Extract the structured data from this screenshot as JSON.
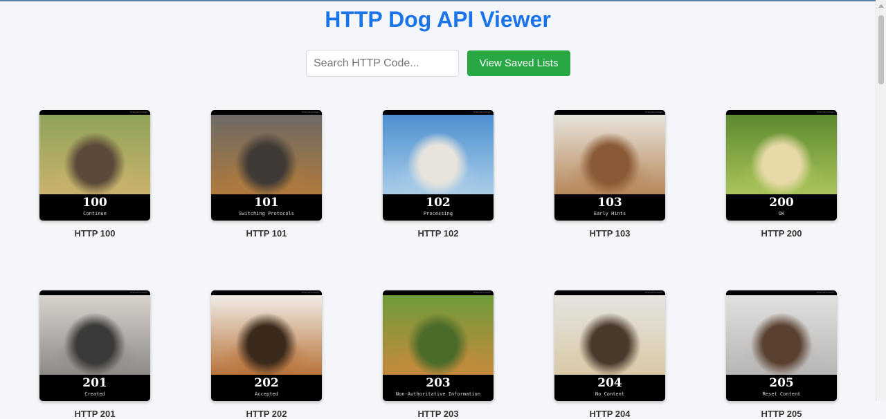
{
  "title": "HTTP Dog API Viewer",
  "search": {
    "placeholder": "Search HTTP Code..."
  },
  "saved_button_label": "View Saved Lists",
  "watermark": "httpstatusdogs",
  "cards": [
    {
      "code": "100",
      "text": "Continue",
      "caption": "HTTP 100",
      "colors": [
        "#8fa35a",
        "#c9b26b",
        "#5b4a3a"
      ]
    },
    {
      "code": "101",
      "text": "Switching Protocols",
      "caption": "HTTP 101",
      "colors": [
        "#6d6a66",
        "#b07a3c",
        "#3f3a36"
      ]
    },
    {
      "code": "102",
      "text": "Processing",
      "caption": "HTTP 102",
      "colors": [
        "#4d8fd0",
        "#a9cde8",
        "#e8e4dc"
      ]
    },
    {
      "code": "103",
      "text": "Early Hints",
      "caption": "HTTP 103",
      "colors": [
        "#e8e4dc",
        "#b6875a",
        "#8a5a36"
      ]
    },
    {
      "code": "200",
      "text": "OK",
      "caption": "HTTP 200",
      "colors": [
        "#5c8a2e",
        "#a9c35a",
        "#e8d9a8"
      ]
    },
    {
      "code": "201",
      "text": "Created",
      "caption": "HTTP 201",
      "colors": [
        "#d8d2cc",
        "#8e8a86",
        "#3c3a38"
      ]
    },
    {
      "code": "202",
      "text": "Accepted",
      "caption": "HTTP 202",
      "colors": [
        "#f0ece6",
        "#b8733a",
        "#3b2a1c"
      ]
    },
    {
      "code": "203",
      "text": "Non-Authoritative Information",
      "caption": "HTTP 203",
      "colors": [
        "#6f9a3a",
        "#c58a3c",
        "#4a6b2a"
      ]
    },
    {
      "code": "204",
      "text": "No Content",
      "caption": "HTTP 204",
      "colors": [
        "#e6e4e0",
        "#d9c9a8",
        "#4a3a2c"
      ]
    },
    {
      "code": "205",
      "text": "Reset Content",
      "caption": "HTTP 205",
      "colors": [
        "#e2e0de",
        "#b8b6b4",
        "#5a4030"
      ]
    }
  ]
}
